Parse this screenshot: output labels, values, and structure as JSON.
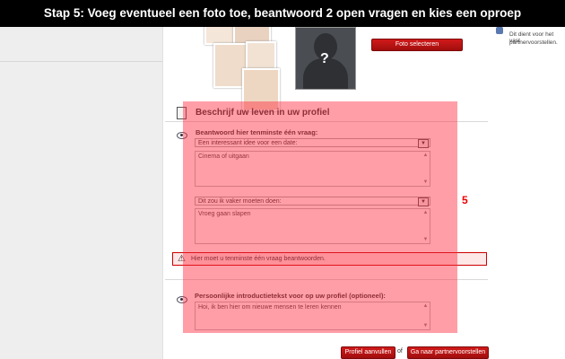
{
  "banner": {
    "text": "Stap 5: Voeg eventueel een foto toe, beantwoord 2 open vragen en kies een oproep"
  },
  "photo": {
    "select_button": "Foto selecteren"
  },
  "silhouette": {
    "mark": "?"
  },
  "right_info": {
    "line1": "Dit dient voor het vast",
    "line2": "partnervoorstellen."
  },
  "section": {
    "title": "Beschrijf uw leven in uw profiel"
  },
  "questions": {
    "instruction": "Beantwoord hier tenminste één vraag:",
    "q1": {
      "selected": "Een interessant idee voor een date:",
      "answer": "Cinema of uitgaan"
    },
    "q2": {
      "selected": "Dit zou ik vaker moeten doen:",
      "answer": "Vroeg gaan slapen"
    }
  },
  "step_marker": "5",
  "error": {
    "text": "Hier moet u tenminste één vraag beantwoorden."
  },
  "intro": {
    "label": "Persoonlijke introductietekst voor op uw profiel (optioneel):",
    "text": "Hoi, ik ben hier om nieuwe mensen te leren kennen"
  },
  "footer": {
    "complete_button": "Profiel aanvullen",
    "or": "of",
    "proposals_button": "Ga naar partnervoorstellen"
  },
  "colors": {
    "accent": "#b5121b",
    "overlay": "#ff2838"
  }
}
